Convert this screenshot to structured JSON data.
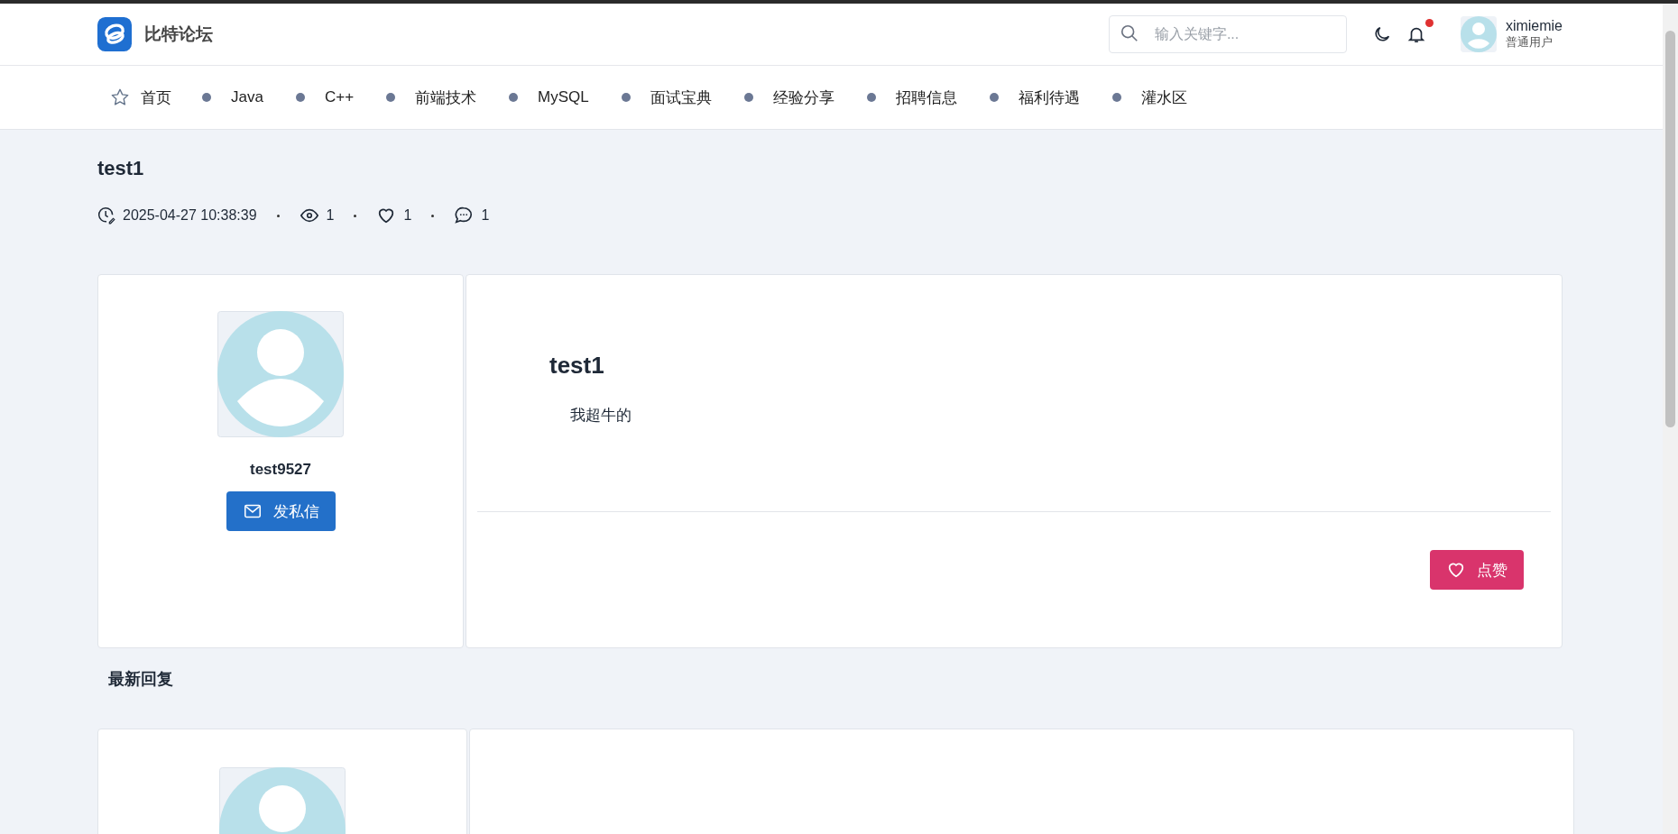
{
  "site": {
    "name": "比特论坛"
  },
  "search": {
    "placeholder": "输入关键字..."
  },
  "notifications": {
    "unread": true
  },
  "user": {
    "name": "ximiemie",
    "role": "普通用户"
  },
  "nav": [
    {
      "label": "首页",
      "kind": "home"
    },
    {
      "label": "Java",
      "kind": "board"
    },
    {
      "label": "C++",
      "kind": "board"
    },
    {
      "label": "前端技术",
      "kind": "board"
    },
    {
      "label": "MySQL",
      "kind": "board"
    },
    {
      "label": "面试宝典",
      "kind": "board"
    },
    {
      "label": "经验分享",
      "kind": "board"
    },
    {
      "label": "招聘信息",
      "kind": "board"
    },
    {
      "label": "福利待遇",
      "kind": "board"
    },
    {
      "label": "灌水区",
      "kind": "board"
    }
  ],
  "post": {
    "title": "test1",
    "time": "2025-04-27 10:38:39",
    "views": "1",
    "likes": "1",
    "comments": "1",
    "author": {
      "name": "test9527",
      "message_button": "发私信"
    },
    "content": {
      "title": "test1",
      "body": "我超牛的"
    },
    "like_button": "点赞"
  },
  "replies": {
    "heading": "最新回复"
  }
}
